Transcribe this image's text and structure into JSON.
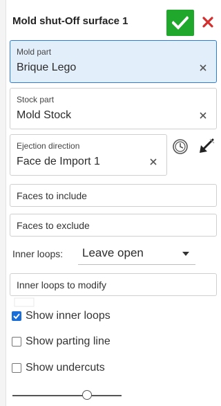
{
  "dialog": {
    "title": "Mold shut-Off surface 1",
    "ok_icon": "checkmark-icon",
    "cancel_icon": "close-icon",
    "accent_ok": "#1fa82b",
    "accent_cancel": "#d32f2f"
  },
  "fields": {
    "mold_part": {
      "label": "Mold part",
      "value": "Brique Lego",
      "active": true
    },
    "stock_part": {
      "label": "Stock part",
      "value": "Mold Stock"
    },
    "ejection": {
      "label": "Ejection direction",
      "value": "Face de Import 1"
    },
    "faces_include": {
      "label": "Faces to include"
    },
    "faces_exclude": {
      "label": "Faces to exclude"
    },
    "inner_loops_modify": {
      "label": "Inner loops to modify"
    }
  },
  "inner_loops": {
    "label": "Inner loops:",
    "selected": "Leave open"
  },
  "checkboxes": [
    {
      "label": "Show inner loops",
      "checked": true
    },
    {
      "label": "Show parting line",
      "checked": false
    },
    {
      "label": "Show undercuts",
      "checked": false
    }
  ],
  "slider": {
    "value": 0.7
  },
  "icons": {
    "clock": "clock-icon",
    "flip": "flip-direction-icon"
  }
}
